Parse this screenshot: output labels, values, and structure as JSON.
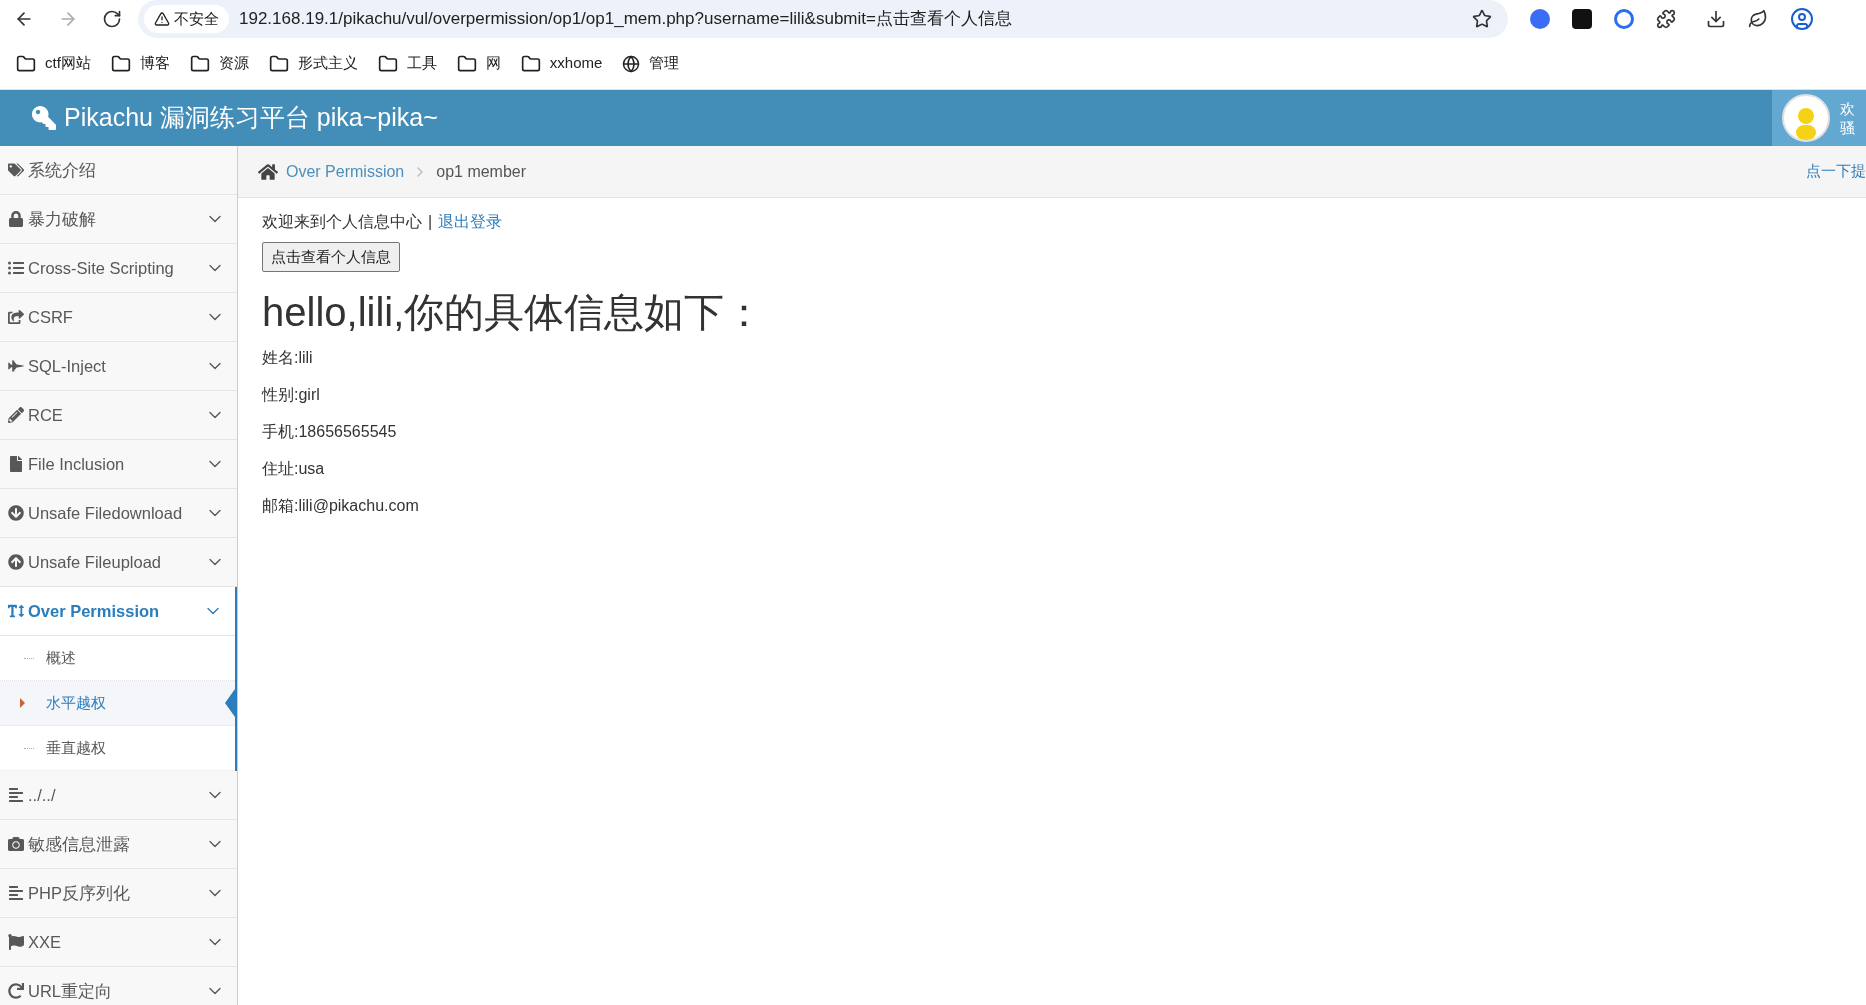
{
  "browser": {
    "security_label": "不安全",
    "url": "192.168.19.1/pikachu/vul/overpermission/op1/op1_mem.php?username=lili&submit=点击查看个人信息",
    "bookmarks": [
      {
        "label": "ctf网站",
        "kind": "folder"
      },
      {
        "label": "博客",
        "kind": "folder"
      },
      {
        "label": "资源",
        "kind": "folder"
      },
      {
        "label": "形式主义",
        "kind": "folder"
      },
      {
        "label": "工具",
        "kind": "folder"
      },
      {
        "label": "网",
        "kind": "folder"
      },
      {
        "label": "xxhome",
        "kind": "folder"
      },
      {
        "label": "管理",
        "kind": "globe"
      }
    ]
  },
  "header": {
    "title": "Pikachu 漏洞练习平台 pika~pika~",
    "user_line_1": "欢",
    "user_line_2": "骚"
  },
  "sidebar": {
    "items": [
      {
        "label": "系统介绍",
        "selected": false,
        "has_caret": false
      },
      {
        "label": "暴力破解",
        "selected": false,
        "has_caret": true
      },
      {
        "label": "Cross-Site Scripting",
        "selected": false,
        "has_caret": true
      },
      {
        "label": "CSRF",
        "selected": false,
        "has_caret": true
      },
      {
        "label": "SQL-Inject",
        "selected": false,
        "has_caret": true
      },
      {
        "label": "RCE",
        "selected": false,
        "has_caret": true
      },
      {
        "label": "File Inclusion",
        "selected": false,
        "has_caret": true
      },
      {
        "label": "Unsafe Filedownload",
        "selected": false,
        "has_caret": true
      },
      {
        "label": "Unsafe Fileupload",
        "selected": false,
        "has_caret": true
      },
      {
        "label": "Over Permission",
        "selected": true,
        "has_caret": true,
        "children": [
          {
            "label": "概述",
            "selected": false
          },
          {
            "label": "水平越权",
            "selected": true
          },
          {
            "label": "垂直越权",
            "selected": false
          }
        ]
      },
      {
        "label": "../../",
        "selected": false,
        "has_caret": true
      },
      {
        "label": "敏感信息泄露",
        "selected": false,
        "has_caret": true
      },
      {
        "label": "PHP反序列化",
        "selected": false,
        "has_caret": true
      },
      {
        "label": "XXE",
        "selected": false,
        "has_caret": true
      },
      {
        "label": "URL重定向",
        "selected": false,
        "has_caret": true
      }
    ]
  },
  "breadcrumb": {
    "items": [
      "Over Permission",
      "op1 member"
    ],
    "hint": "点一下提"
  },
  "content": {
    "welcome": "欢迎来到个人信息中心",
    "separator": "|",
    "logout_link": "退出登录",
    "button": "点击查看个人信息",
    "heading": "hello,lili,你的具体信息如下：",
    "fields": [
      "姓名:lili",
      "性别:girl",
      "手机:18656565545",
      "住址:usa",
      "邮箱:lili@pikachu.com"
    ]
  }
}
